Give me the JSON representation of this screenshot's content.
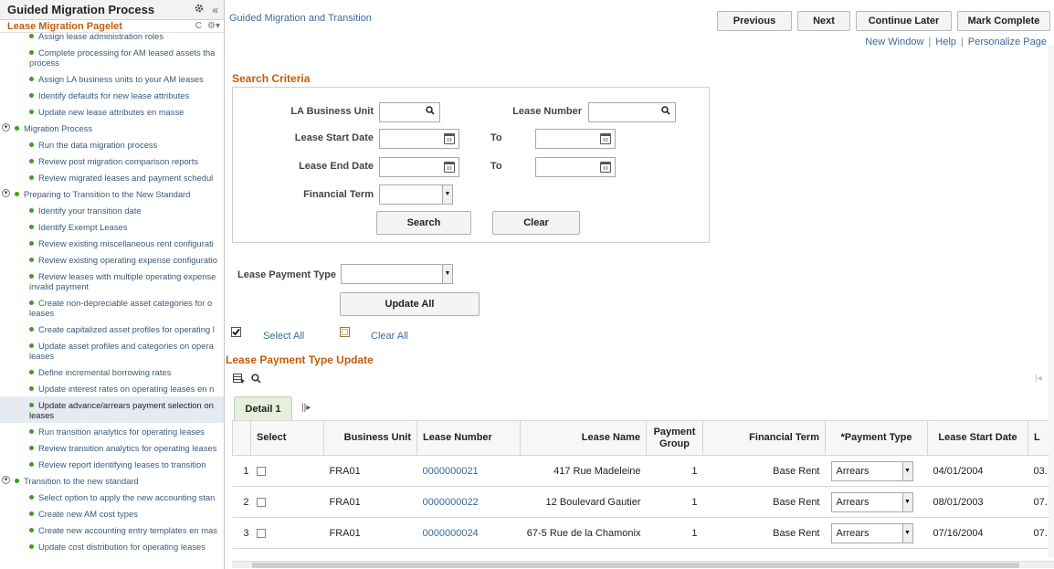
{
  "pagelet": {
    "title": "Guided Migration Process",
    "gear_icon": "gear-icon",
    "collapse_icon": "«",
    "subtitle": "Lease Migration Pagelet",
    "refresh_icon": "C",
    "settings_icon": "⚙▾"
  },
  "tree": [
    {
      "t": "Assign lease administration roles",
      "lvl": 2
    },
    {
      "t": "Complete processing for AM leased assets tha",
      "t2": "process",
      "lvl": 2
    },
    {
      "t": "Assign LA business units to your AM leases",
      "lvl": 2
    },
    {
      "t": "Identify defaults for new lease attributes",
      "lvl": 2
    },
    {
      "t": "Update new lease attributes en masse",
      "lvl": 2
    },
    {
      "t": "Migration Process",
      "lvl": 1
    },
    {
      "t": "Run the data migration process",
      "lvl": 2
    },
    {
      "t": "Review post migration comparison reports",
      "lvl": 2
    },
    {
      "t": "Review migrated leases and payment schedul",
      "lvl": 2
    },
    {
      "t": "Preparing to Transition to the New Standard",
      "lvl": 1
    },
    {
      "t": "Identify your transition date",
      "lvl": 2
    },
    {
      "t": "Identify Exempt Leases",
      "lvl": 2
    },
    {
      "t": "Review existing miscellaneous rent configurati",
      "lvl": 2
    },
    {
      "t": "Review existing operating expense configuratio",
      "lvl": 2
    },
    {
      "t": "Review leases with multiple operating expense",
      "t2": "invalid payment",
      "lvl": 2
    },
    {
      "t": "Create non-depreciable asset categories for o",
      "t2": "leases",
      "lvl": 2
    },
    {
      "t": "Create capitalized asset profiles for operating l",
      "lvl": 2
    },
    {
      "t": "Update asset profiles and categories on opera",
      "t2": "leases",
      "lvl": 2
    },
    {
      "t": "Define incremental borrowing rates",
      "lvl": 2
    },
    {
      "t": "Update interest rates on operating leases en n",
      "lvl": 2
    },
    {
      "t": "Update advance/arrears payment selection on",
      "t2": "leases",
      "lvl": 2,
      "sel": true
    },
    {
      "t": "Run transition analytics for operating leases",
      "lvl": 2
    },
    {
      "t": "Review transition analytics for operating leases",
      "lvl": 2
    },
    {
      "t": "Review report identifying leases to transition",
      "lvl": 2
    },
    {
      "t": "Transition to the new standard",
      "lvl": 1
    },
    {
      "t": "Select option to apply the new accounting stan",
      "lvl": 2
    },
    {
      "t": "Create new AM cost types",
      "lvl": 2
    },
    {
      "t": "Create new accounting entry templates en mas",
      "lvl": 2
    },
    {
      "t": "Update cost distribution for operating leases",
      "lvl": 2
    }
  ],
  "header": {
    "title": "Guided Migration and Transition",
    "previous": "Previous",
    "next": "Next",
    "continue_later": "Continue Later",
    "mark_complete": "Mark Complete",
    "new_window": "New Window",
    "help": "Help",
    "personalize": "Personalize Page",
    "sep": "|"
  },
  "criteria": {
    "title": "Search Criteria",
    "bu_label": "LA Business Unit",
    "lease_number_label": "Lease Number",
    "start_label": "Lease Start Date",
    "end_label": "Lease End Date",
    "to_label": "To",
    "term_label": "Financial Term",
    "search": "Search",
    "clear": "Clear"
  },
  "update": {
    "payment_type_label": "Lease Payment Type",
    "update_all": "Update All",
    "select_all": "Select All",
    "clear_all": "Clear All"
  },
  "grid": {
    "title": "Lease Payment Type Update",
    "tab": "Detail 1",
    "columns": [
      "",
      "Select",
      "Business Unit",
      "Lease Number",
      "Lease Name",
      "Payment Group",
      "Financial Term",
      "*Payment Type",
      "Lease Start Date",
      "L"
    ],
    "rows": [
      {
        "n": "1",
        "bu": "FRA01",
        "lease": "0000000021",
        "name": "417 Rue Madeleine",
        "group": "1",
        "term": "Base Rent",
        "ptype": "Arrears",
        "start": "04/01/2004",
        "end": "03."
      },
      {
        "n": "2",
        "bu": "FRA01",
        "lease": "0000000022",
        "name": "12 Boulevard Gautier",
        "group": "1",
        "term": "Base Rent",
        "ptype": "Arrears",
        "start": "08/01/2003",
        "end": "07."
      },
      {
        "n": "3",
        "bu": "FRA01",
        "lease": "0000000024",
        "name": "67-5 Rue de la Chamonix",
        "group": "1",
        "term": "Base Rent",
        "ptype": "Arrears",
        "start": "07/16/2004",
        "end": "07."
      }
    ]
  },
  "colors": {
    "accent": "#c25e0b",
    "link": "#3a6a9a",
    "bullet": "#3aa01f",
    "tab": "#e4f0dc"
  }
}
